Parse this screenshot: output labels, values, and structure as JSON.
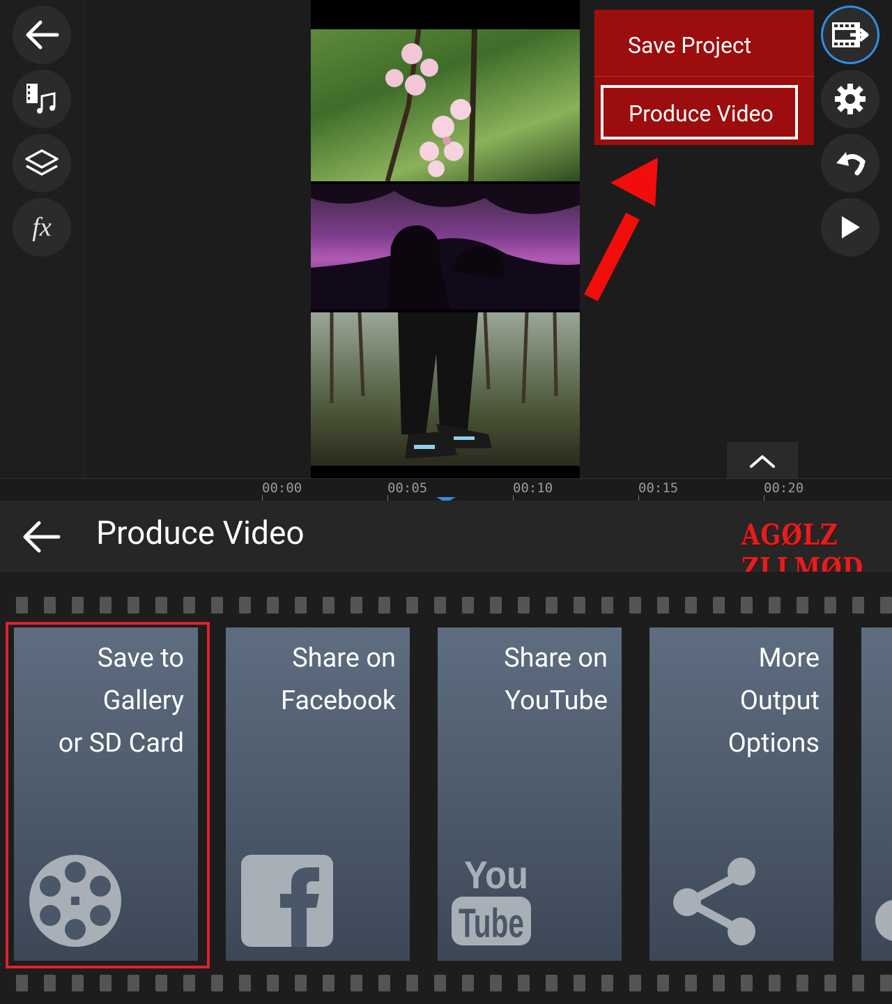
{
  "editor": {
    "left_toolbar": [
      {
        "name": "back",
        "icon": "arrow-left-icon"
      },
      {
        "name": "media",
        "icon": "film-music-icon"
      },
      {
        "name": "layers",
        "icon": "layers-icon"
      },
      {
        "name": "effects",
        "icon": "fx-icon",
        "label": "fx"
      }
    ],
    "right_toolbar": [
      {
        "name": "export",
        "icon": "export-film-icon",
        "accent": "#2f8fe8"
      },
      {
        "name": "settings",
        "icon": "gear-icon"
      },
      {
        "name": "undo",
        "icon": "undo-icon"
      },
      {
        "name": "play",
        "icon": "play-icon"
      }
    ],
    "export_menu": {
      "save_project": "Save Project",
      "produce_video": "Produce Video",
      "background": "#9c0d0d"
    },
    "timeline": {
      "ticks": [
        "00:00",
        "00:05",
        "00:10",
        "00:15",
        "00:20"
      ],
      "playhead_color": "#2f8fe8"
    }
  },
  "panel": {
    "title": "Produce Video",
    "watermark": "AGØLZ ZLLMØD",
    "options": [
      {
        "lines": [
          "Save to",
          "Gallery",
          "or SD Card"
        ],
        "icon": "film-reel-icon",
        "highlighted": true
      },
      {
        "lines": [
          "Share on",
          "Facebook"
        ],
        "icon": "facebook-icon"
      },
      {
        "lines": [
          "Share on",
          "YouTube"
        ],
        "icon": "youtube-icon"
      },
      {
        "lines": [
          "More",
          "Output",
          "Options"
        ],
        "icon": "share-icon"
      }
    ],
    "highlight_color": "#e1202f"
  }
}
